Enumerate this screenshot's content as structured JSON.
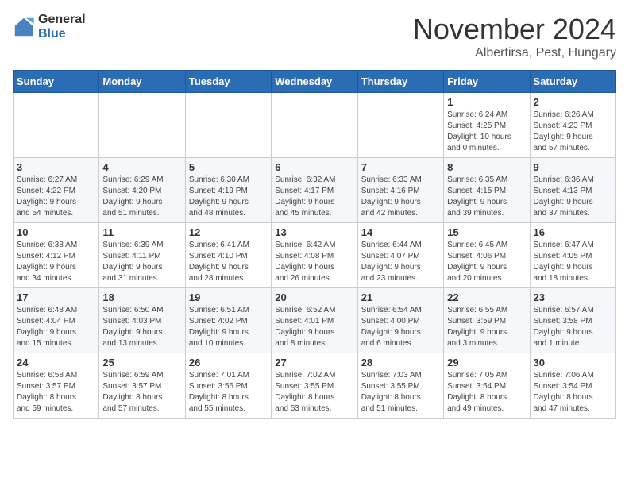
{
  "logo": {
    "general": "General",
    "blue": "Blue"
  },
  "title": {
    "month_year": "November 2024",
    "location": "Albertirsa, Pest, Hungary"
  },
  "headers": [
    "Sunday",
    "Monday",
    "Tuesday",
    "Wednesday",
    "Thursday",
    "Friday",
    "Saturday"
  ],
  "weeks": [
    [
      {
        "day": "",
        "info": ""
      },
      {
        "day": "",
        "info": ""
      },
      {
        "day": "",
        "info": ""
      },
      {
        "day": "",
        "info": ""
      },
      {
        "day": "",
        "info": ""
      },
      {
        "day": "1",
        "info": "Sunrise: 6:24 AM\nSunset: 4:25 PM\nDaylight: 10 hours\nand 0 minutes."
      },
      {
        "day": "2",
        "info": "Sunrise: 6:26 AM\nSunset: 4:23 PM\nDaylight: 9 hours\nand 57 minutes."
      }
    ],
    [
      {
        "day": "3",
        "info": "Sunrise: 6:27 AM\nSunset: 4:22 PM\nDaylight: 9 hours\nand 54 minutes."
      },
      {
        "day": "4",
        "info": "Sunrise: 6:29 AM\nSunset: 4:20 PM\nDaylight: 9 hours\nand 51 minutes."
      },
      {
        "day": "5",
        "info": "Sunrise: 6:30 AM\nSunset: 4:19 PM\nDaylight: 9 hours\nand 48 minutes."
      },
      {
        "day": "6",
        "info": "Sunrise: 6:32 AM\nSunset: 4:17 PM\nDaylight: 9 hours\nand 45 minutes."
      },
      {
        "day": "7",
        "info": "Sunrise: 6:33 AM\nSunset: 4:16 PM\nDaylight: 9 hours\nand 42 minutes."
      },
      {
        "day": "8",
        "info": "Sunrise: 6:35 AM\nSunset: 4:15 PM\nDaylight: 9 hours\nand 39 minutes."
      },
      {
        "day": "9",
        "info": "Sunrise: 6:36 AM\nSunset: 4:13 PM\nDaylight: 9 hours\nand 37 minutes."
      }
    ],
    [
      {
        "day": "10",
        "info": "Sunrise: 6:38 AM\nSunset: 4:12 PM\nDaylight: 9 hours\nand 34 minutes."
      },
      {
        "day": "11",
        "info": "Sunrise: 6:39 AM\nSunset: 4:11 PM\nDaylight: 9 hours\nand 31 minutes."
      },
      {
        "day": "12",
        "info": "Sunrise: 6:41 AM\nSunset: 4:10 PM\nDaylight: 9 hours\nand 28 minutes."
      },
      {
        "day": "13",
        "info": "Sunrise: 6:42 AM\nSunset: 4:08 PM\nDaylight: 9 hours\nand 26 minutes."
      },
      {
        "day": "14",
        "info": "Sunrise: 6:44 AM\nSunset: 4:07 PM\nDaylight: 9 hours\nand 23 minutes."
      },
      {
        "day": "15",
        "info": "Sunrise: 6:45 AM\nSunset: 4:06 PM\nDaylight: 9 hours\nand 20 minutes."
      },
      {
        "day": "16",
        "info": "Sunrise: 6:47 AM\nSunset: 4:05 PM\nDaylight: 9 hours\nand 18 minutes."
      }
    ],
    [
      {
        "day": "17",
        "info": "Sunrise: 6:48 AM\nSunset: 4:04 PM\nDaylight: 9 hours\nand 15 minutes."
      },
      {
        "day": "18",
        "info": "Sunrise: 6:50 AM\nSunset: 4:03 PM\nDaylight: 9 hours\nand 13 minutes."
      },
      {
        "day": "19",
        "info": "Sunrise: 6:51 AM\nSunset: 4:02 PM\nDaylight: 9 hours\nand 10 minutes."
      },
      {
        "day": "20",
        "info": "Sunrise: 6:52 AM\nSunset: 4:01 PM\nDaylight: 9 hours\nand 8 minutes."
      },
      {
        "day": "21",
        "info": "Sunrise: 6:54 AM\nSunset: 4:00 PM\nDaylight: 9 hours\nand 6 minutes."
      },
      {
        "day": "22",
        "info": "Sunrise: 6:55 AM\nSunset: 3:59 PM\nDaylight: 9 hours\nand 3 minutes."
      },
      {
        "day": "23",
        "info": "Sunrise: 6:57 AM\nSunset: 3:58 PM\nDaylight: 9 hours\nand 1 minute."
      }
    ],
    [
      {
        "day": "24",
        "info": "Sunrise: 6:58 AM\nSunset: 3:57 PM\nDaylight: 8 hours\nand 59 minutes."
      },
      {
        "day": "25",
        "info": "Sunrise: 6:59 AM\nSunset: 3:57 PM\nDaylight: 8 hours\nand 57 minutes."
      },
      {
        "day": "26",
        "info": "Sunrise: 7:01 AM\nSunset: 3:56 PM\nDaylight: 8 hours\nand 55 minutes."
      },
      {
        "day": "27",
        "info": "Sunrise: 7:02 AM\nSunset: 3:55 PM\nDaylight: 8 hours\nand 53 minutes."
      },
      {
        "day": "28",
        "info": "Sunrise: 7:03 AM\nSunset: 3:55 PM\nDaylight: 8 hours\nand 51 minutes."
      },
      {
        "day": "29",
        "info": "Sunrise: 7:05 AM\nSunset: 3:54 PM\nDaylight: 8 hours\nand 49 minutes."
      },
      {
        "day": "30",
        "info": "Sunrise: 7:06 AM\nSunset: 3:54 PM\nDaylight: 8 hours\nand 47 minutes."
      }
    ]
  ]
}
